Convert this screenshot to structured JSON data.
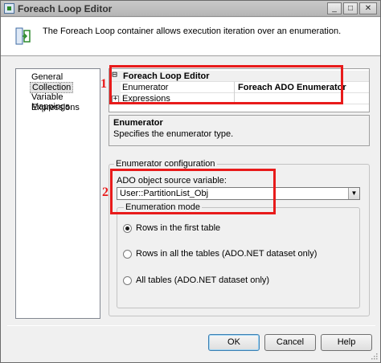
{
  "window": {
    "title": "Foreach Loop Editor",
    "controls": {
      "minimize": "_",
      "maximize": "□",
      "close": "✕"
    }
  },
  "header": {
    "description": "The Foreach Loop container allows execution iteration over an enumeration.",
    "icon": "foreach-loop-icon"
  },
  "nav": {
    "items": [
      {
        "label": "General",
        "selected": false
      },
      {
        "label": "Collection",
        "selected": true
      },
      {
        "label": "Variable Mappings",
        "selected": false
      },
      {
        "label": "Expressions",
        "selected": false
      }
    ]
  },
  "property_grid": {
    "category": {
      "expander": "⊟",
      "title": "Foreach Loop Editor"
    },
    "rows": [
      {
        "name": "Enumerator",
        "value": "Foreach ADO Enumerator"
      },
      {
        "expander": "+",
        "name": "Expressions",
        "value": ""
      }
    ]
  },
  "description_panel": {
    "title": "Enumerator",
    "text": "Specifies the enumerator type."
  },
  "enumerator_config": {
    "legend": "Enumerator configuration",
    "source_variable_label": "ADO object source variable:",
    "source_variable_value": "User::PartitionList_Obj",
    "enumeration_mode": {
      "legend": "Enumeration mode",
      "options": [
        {
          "label": "Rows in the first table",
          "checked": true
        },
        {
          "label": "Rows in all the tables (ADO.NET dataset only)",
          "checked": false
        },
        {
          "label": "All tables (ADO.NET dataset only)",
          "checked": false
        }
      ]
    }
  },
  "annotations": {
    "label_1": "1",
    "label_2": "2",
    "color": "#e81b1b"
  },
  "buttons": {
    "ok": "OK",
    "cancel": "Cancel",
    "help": "Help"
  }
}
